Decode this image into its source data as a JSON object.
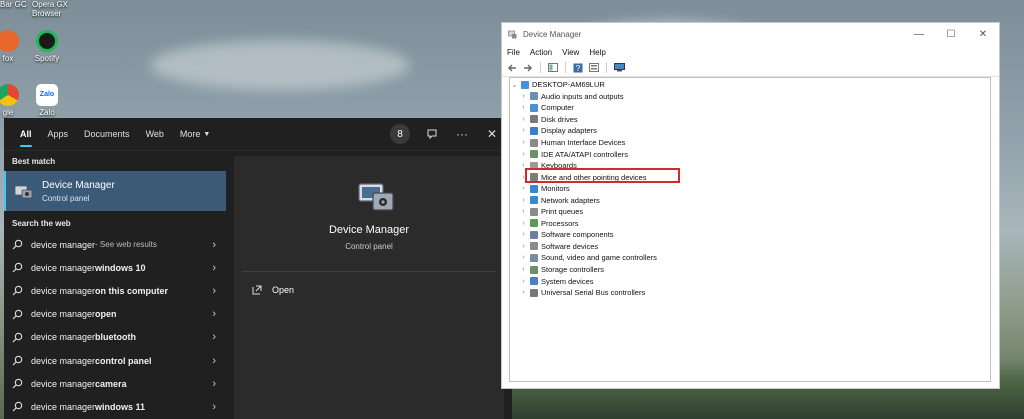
{
  "desktop": {
    "top_labels": [
      "Bar GC",
      "Opera GX",
      "Browser"
    ],
    "icons": [
      {
        "label": "fox",
        "icon": "firefox-icon",
        "color": "#e8672a"
      },
      {
        "label": "Spotify",
        "icon": "spotify-icon",
        "color": "#1db954"
      },
      {
        "label": "gle",
        "icon": "chrome-icon",
        "color": "#e6462e"
      },
      {
        "label": "Zalo",
        "icon": "zalo-icon",
        "color": "#0a68ff"
      }
    ]
  },
  "search_panel": {
    "tabs": [
      "All",
      "Apps",
      "Documents",
      "Web",
      "More"
    ],
    "active_tab": "All",
    "badge_count": "8",
    "best_match_header": "Best match",
    "best_match": {
      "title": "Device Manager",
      "subtitle": "Control panel"
    },
    "web_header": "Search the web",
    "web_results": [
      {
        "prefix": "device manager",
        "bold": "",
        "suffix": " - See web results"
      },
      {
        "prefix": "device manager ",
        "bold": "windows 10",
        "suffix": ""
      },
      {
        "prefix": "device manager ",
        "bold": "on this computer",
        "suffix": ""
      },
      {
        "prefix": "device manager ",
        "bold": "open",
        "suffix": ""
      },
      {
        "prefix": "device manager ",
        "bold": "bluetooth",
        "suffix": ""
      },
      {
        "prefix": "device manager ",
        "bold": "control panel",
        "suffix": ""
      },
      {
        "prefix": "device manager ",
        "bold": "camera",
        "suffix": ""
      },
      {
        "prefix": "device manager ",
        "bold": "windows 11",
        "suffix": ""
      }
    ],
    "preview": {
      "title": "Device Manager",
      "subtitle": "Control panel",
      "open_label": "Open"
    }
  },
  "device_manager": {
    "title": "Device Manager",
    "menu": [
      "File",
      "Action",
      "View",
      "Help"
    ],
    "root": "DESKTOP-AM69LUR",
    "categories": [
      {
        "label": "Audio inputs and outputs",
        "color": "#6a8fb5"
      },
      {
        "label": "Computer",
        "color": "#4a90d9"
      },
      {
        "label": "Disk drives",
        "color": "#7a7a7a"
      },
      {
        "label": "Display adapters",
        "color": "#3c7fc9"
      },
      {
        "label": "Human Interface Devices",
        "color": "#8a8a8a"
      },
      {
        "label": "IDE ATA/ATAPI controllers",
        "color": "#6b8e6b"
      },
      {
        "label": "Keyboards",
        "color": "#9a9a9a"
      },
      {
        "label": "Mice and other pointing devices",
        "color": "#7d7d7d"
      },
      {
        "label": "Monitors",
        "color": "#3a86d1"
      },
      {
        "label": "Network adapters",
        "color": "#3a86d1"
      },
      {
        "label": "Print queues",
        "color": "#8a8a8a"
      },
      {
        "label": "Processors",
        "color": "#5a9a5a"
      },
      {
        "label": "Software components",
        "color": "#6d7fa0"
      },
      {
        "label": "Software devices",
        "color": "#8a8a8a"
      },
      {
        "label": "Sound, video and game controllers",
        "color": "#7a8aa0"
      },
      {
        "label": "Storage controllers",
        "color": "#6b8e6b"
      },
      {
        "label": "System devices",
        "color": "#4a80c0"
      },
      {
        "label": "Universal Serial Bus controllers",
        "color": "#777777"
      }
    ],
    "highlighted": "Mice and other pointing devices",
    "highlight_color": "#d12a2a"
  }
}
